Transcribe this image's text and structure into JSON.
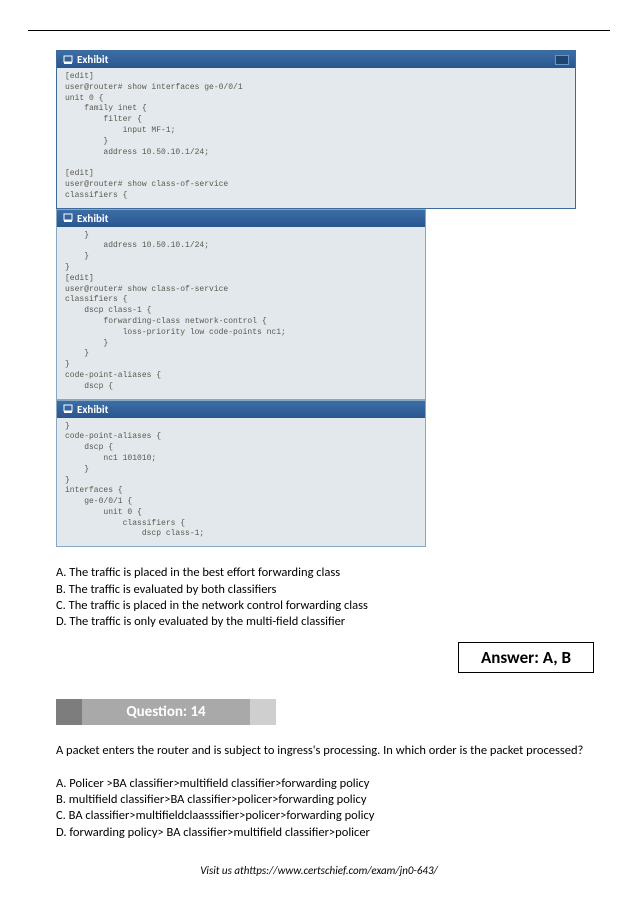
{
  "exhibits": {
    "bar_label": "Exhibit",
    "panel1": "[edit]\nuser@router# show interfaces ge-0/0/1\nunit 0 {\n    family inet {\n        filter {\n            input MF-1;\n        }\n        address 10.50.10.1/24;\n\n[edit]\nuser@router# show class-of-service\nclassifiers {",
    "panel2": "    }\n        address 10.50.10.1/24;\n    }\n}\n[edit]\nuser@router# show class-of-service\nclassifiers {\n    dscp class-1 {\n        forwarding-class network-control {\n            loss-priority low code-points nc1;\n        }\n    }\n}\ncode-point-aliases {\n    dscp {",
    "panel3": "}\ncode-point-aliases {\n    dscp {\n        nc1 101010;\n    }\n}\ninterfaces {\n    ge-0/0/1 {\n        unit 0 {\n            classifiers {\n                dscp class-1;\n"
  },
  "options": {
    "a": "A. The traffic is placed in the best effort forwarding class",
    "b": "B. The traffic is evaluated by both classifiers",
    "c": "C. The traffic is placed in the network control forwarding class",
    "d": "D. The traffic is only evaluated by the multi-field classifier"
  },
  "answer": "Answer: A, B",
  "question_bar": "Question: 14",
  "q14": {
    "prompt": "A packet enters the router and is subject to ingress's processing. In which order is the packet processed?",
    "a": "A. Policer >BA classifier>multifield classifier>forwarding policy",
    "b": "B. multifield classifier>BA classifier>policer>forwarding policy",
    "c": "C. BA classifier>multifieldclaasssifier>policer>forwarding policy",
    "d": "D. forwarding policy> BA classifier>multifield classifier>policer"
  },
  "footer": "Visit us athttps://www.certschief.com/exam/jn0-643/"
}
